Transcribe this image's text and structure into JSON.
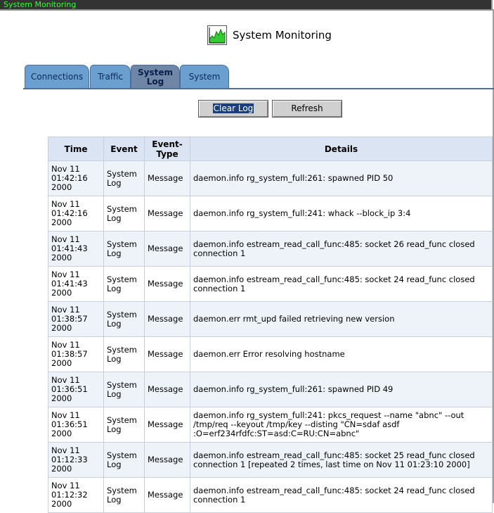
{
  "window": {
    "title": "System Monitoring"
  },
  "header": {
    "title": "System Monitoring",
    "icon": "chart-icon"
  },
  "tabs": [
    {
      "label": "Connections",
      "active": false
    },
    {
      "label": "Traffic",
      "active": false
    },
    {
      "label": "System Log",
      "active": true
    },
    {
      "label": "System",
      "active": false
    }
  ],
  "buttons": {
    "clear_log": "Clear Log",
    "refresh": "Refresh"
  },
  "table": {
    "headers": {
      "time": "Time",
      "event": "Event",
      "event_type": "Event-Type",
      "details": "Details"
    },
    "rows": [
      {
        "date": "Nov 11",
        "time": "01:42:16",
        "year": "2000",
        "event": "System Log",
        "event_type": "Message",
        "details": "daemon.info rg_system_full:261: spawned PID 50"
      },
      {
        "date": "Nov 11",
        "time": "01:42:16",
        "year": "2000",
        "event": "System Log",
        "event_type": "Message",
        "details": "daemon.info rg_system_full:241: whack --block_ip 3:4"
      },
      {
        "date": "Nov 11",
        "time": "01:41:43",
        "year": "2000",
        "event": "System Log",
        "event_type": "Message",
        "details": "daemon.info estream_read_call_func:485: socket 26 read_func closed connection 1"
      },
      {
        "date": "Nov 11",
        "time": "01:41:43",
        "year": "2000",
        "event": "System Log",
        "event_type": "Message",
        "details": "daemon.info estream_read_call_func:485: socket 24 read_func closed connection 1"
      },
      {
        "date": "Nov 11",
        "time": "01:38:57",
        "year": "2000",
        "event": "System Log",
        "event_type": "Message",
        "details": "daemon.err rmt_upd failed retrieving new version"
      },
      {
        "date": "Nov 11",
        "time": "01:38:57",
        "year": "2000",
        "event": "System Log",
        "event_type": "Message",
        "details": "daemon.err Error resolving hostname"
      },
      {
        "date": "Nov 11",
        "time": "01:36:51",
        "year": "2000",
        "event": "System Log",
        "event_type": "Message",
        "details": "daemon.info rg_system_full:261: spawned PID 49"
      },
      {
        "date": "Nov 11",
        "time": "01:36:51",
        "year": "2000",
        "event": "System Log",
        "event_type": "Message",
        "details": "daemon.info rg_system_full:241: pkcs_request --name \"abnc\" --out /tmp/req --keyout /tmp/key --disting \"CN=sdaf asdf :O=erf234rfdfc:ST=asd:C=RU:CN=abnc\""
      },
      {
        "date": "Nov 11",
        "time": "01:12:33",
        "year": "2000",
        "event": "System Log",
        "event_type": "Message",
        "details": "daemon.info estream_read_call_func:485: socket 25 read_func closed connection 1 [repeated 2 times, last time on Nov 11 01:23:10 2000]"
      },
      {
        "date": "Nov 11",
        "time": "01:12:32",
        "year": "2000",
        "event": "System Log",
        "event_type": "Message",
        "details": "daemon.info estream_read_call_func:485: socket 24 read_func closed connection 1"
      }
    ]
  }
}
